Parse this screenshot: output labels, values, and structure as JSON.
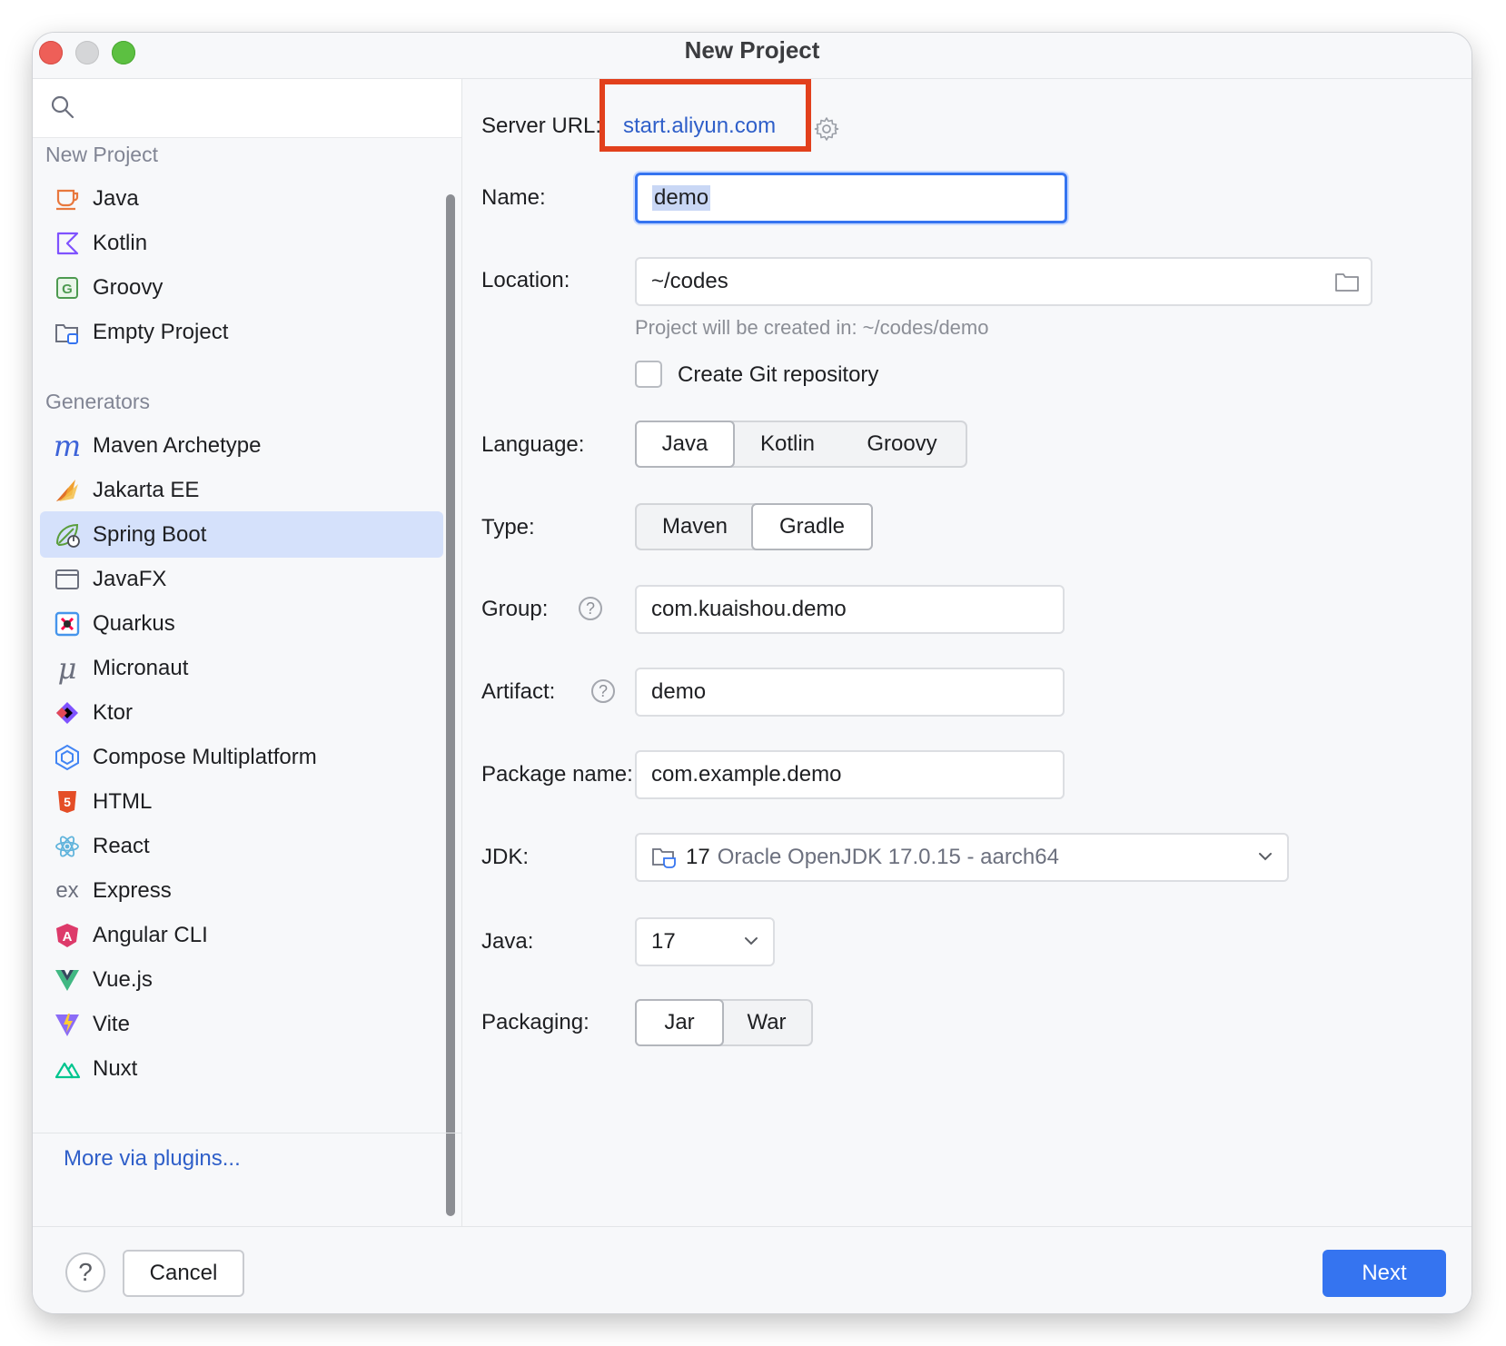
{
  "window": {
    "title": "New Project"
  },
  "sidebar": {
    "search_placeholder": "",
    "sections": {
      "new_project": "New Project",
      "generators": "Generators"
    },
    "new_project_items": [
      {
        "label": "Java",
        "icon": "java-cup-icon"
      },
      {
        "label": "Kotlin",
        "icon": "kotlin-icon"
      },
      {
        "label": "Groovy",
        "icon": "groovy-icon"
      },
      {
        "label": "Empty Project",
        "icon": "empty-project-icon"
      }
    ],
    "generator_items": [
      {
        "label": "Maven Archetype",
        "icon": "maven-icon"
      },
      {
        "label": "Jakarta EE",
        "icon": "jakarta-icon"
      },
      {
        "label": "Spring Boot",
        "icon": "spring-boot-icon",
        "selected": true
      },
      {
        "label": "JavaFX",
        "icon": "javafx-icon"
      },
      {
        "label": "Quarkus",
        "icon": "quarkus-icon"
      },
      {
        "label": "Micronaut",
        "icon": "micronaut-icon"
      },
      {
        "label": "Ktor",
        "icon": "ktor-icon"
      },
      {
        "label": "Compose Multiplatform",
        "icon": "compose-icon"
      },
      {
        "label": "HTML",
        "icon": "html5-icon"
      },
      {
        "label": "React",
        "icon": "react-icon"
      },
      {
        "label": "Express",
        "icon": "express-icon"
      },
      {
        "label": "Angular CLI",
        "icon": "angular-icon"
      },
      {
        "label": "Vue.js",
        "icon": "vue-icon"
      },
      {
        "label": "Vite",
        "icon": "vite-icon"
      },
      {
        "label": "Nuxt",
        "icon": "nuxt-icon"
      }
    ],
    "more_plugins": "More via plugins..."
  },
  "form": {
    "server_url_label": "Server URL:",
    "server_url_value": "start.aliyun.com",
    "name_label": "Name:",
    "name_value": "demo",
    "location_label": "Location:",
    "location_value": "~/codes",
    "location_hint": "Project will be created in: ~/codes/demo",
    "git_label": "Create Git repository",
    "git_checked": false,
    "language_label": "Language:",
    "language_options": [
      "Java",
      "Kotlin",
      "Groovy"
    ],
    "language_selected": "Java",
    "type_label": "Type:",
    "type_options": [
      "Maven",
      "Gradle"
    ],
    "type_selected": "Gradle",
    "group_label": "Group:",
    "group_value": "com.kuaishou.demo",
    "artifact_label": "Artifact:",
    "artifact_value": "demo",
    "package_label": "Package name:",
    "package_value": "com.example.demo",
    "jdk_label": "JDK:",
    "jdk_version": "17",
    "jdk_name": "Oracle OpenJDK 17.0.15 - aarch64",
    "java_label": "Java:",
    "java_value": "17",
    "packaging_label": "Packaging:",
    "packaging_options": [
      "Jar",
      "War"
    ],
    "packaging_selected": "Jar"
  },
  "footer": {
    "help_label": "?",
    "cancel_label": "Cancel",
    "next_label": "Next"
  },
  "colors": {
    "accent": "#3574f0",
    "link": "#2f5fc9",
    "selection": "#d5e1fb",
    "highlight_box": "#e2401c"
  }
}
